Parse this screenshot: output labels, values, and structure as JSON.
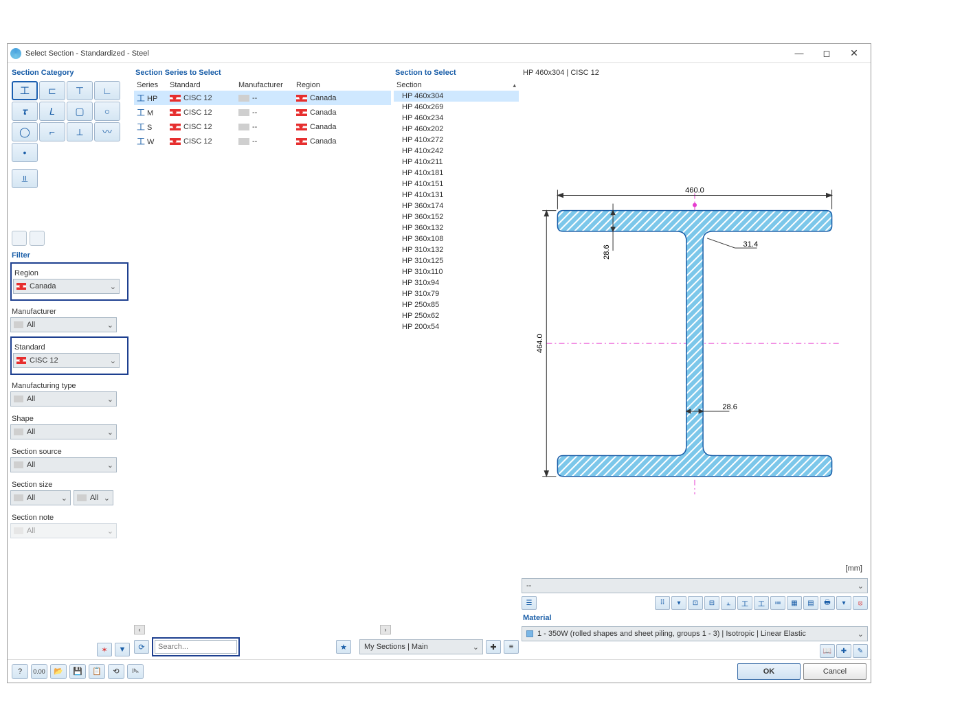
{
  "window": {
    "title": "Select Section - Standardized - Steel"
  },
  "headings": {
    "category": "Section Category",
    "filter": "Filter",
    "series": "Section Series to Select",
    "section": "Section to Select",
    "material": "Material"
  },
  "filters": {
    "region_lbl": "Region",
    "region_val": "Canada",
    "manu_lbl": "Manufacturer",
    "manu_val": "All",
    "std_lbl": "Standard",
    "std_val": "CISC 12",
    "mtype_lbl": "Manufacturing type",
    "mtype_val": "All",
    "shape_lbl": "Shape",
    "shape_val": "All",
    "source_lbl": "Section source",
    "source_val": "All",
    "size_lbl": "Section size",
    "size_a": "All",
    "size_b": "All",
    "note_lbl": "Section note",
    "note_val": "All"
  },
  "series_cols": {
    "series": "Series",
    "standard": "Standard",
    "manuf": "Manufacturer",
    "region": "Region"
  },
  "series": [
    {
      "s": "HP",
      "std": "CISC 12",
      "man": "--",
      "reg": "Canada",
      "sel": true
    },
    {
      "s": "M",
      "std": "CISC 12",
      "man": "--",
      "reg": "Canada"
    },
    {
      "s": "S",
      "std": "CISC 12",
      "man": "--",
      "reg": "Canada"
    },
    {
      "s": "W",
      "std": "CISC 12",
      "man": "--",
      "reg": "Canada"
    }
  ],
  "section_col": "Section",
  "sections": [
    "HP 460x304",
    "HP 460x269",
    "HP 460x234",
    "HP 460x202",
    "HP 410x272",
    "HP 410x242",
    "HP 410x211",
    "HP 410x181",
    "HP 410x151",
    "HP 410x131",
    "HP 360x174",
    "HP 360x152",
    "HP 360x132",
    "HP 360x108",
    "HP 310x132",
    "HP 310x125",
    "HP 310x110",
    "HP 310x94",
    "HP 310x79",
    "HP 250x85",
    "HP 250x62",
    "HP 200x54"
  ],
  "preview": {
    "label": "HP 460x304 | CISC 12",
    "unit": "[mm]",
    "dash": "--",
    "dim_width": "460.0",
    "dim_height": "464.0",
    "dim_tf": "28.6",
    "dim_r": "31.4",
    "dim_tw": "28.6"
  },
  "material_val": "1 - 350W (rolled shapes and sheet piling, groups 1 - 3) | Isotropic | Linear Elastic",
  "search_placeholder": "Search...",
  "my_sections": "My Sections | Main",
  "ok": "OK",
  "cancel": "Cancel"
}
